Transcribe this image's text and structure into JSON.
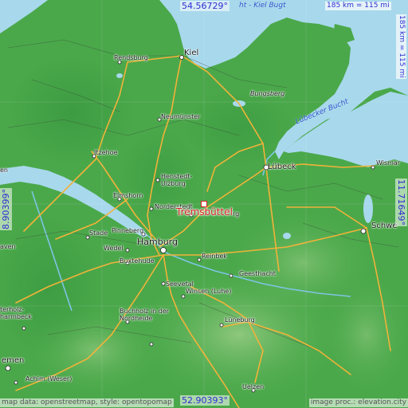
{
  "coords": {
    "north": "54.56729°",
    "south": "52.90393°",
    "west": "8.90399°",
    "east": "11.71649°"
  },
  "scale": {
    "horizontal": "185 km = 115 mi",
    "vertical": "185 km = 115 mi"
  },
  "water_labels": {
    "kiel_bay": "ht - Kiel Bugt",
    "luebeck_bay": "Lübecker Bucht"
  },
  "place": {
    "name": "Tremsbüttel"
  },
  "cities": [
    {
      "id": "kiel",
      "label": "Kiel",
      "size": "mid"
    },
    {
      "id": "rendsburg",
      "label": "Rendsburg",
      "size": "small"
    },
    {
      "id": "bungsberg",
      "label": "Bungsberg",
      "size": "small"
    },
    {
      "id": "neumuenster",
      "label": "Neumünster",
      "size": "small"
    },
    {
      "id": "itzehoe",
      "label": "Itzehoe",
      "size": "small"
    },
    {
      "id": "luebeck",
      "label": "Lübeck",
      "size": "mid"
    },
    {
      "id": "wismar",
      "label": "Wismar",
      "size": "small"
    },
    {
      "id": "henstedt",
      "label": "Henstedt-\nUlzburg",
      "size": "small"
    },
    {
      "id": "norderstedt",
      "label": "Norderstedt",
      "size": "small"
    },
    {
      "id": "elmshorn",
      "label": "Elmshorn",
      "size": "small"
    },
    {
      "id": "ahrensburg",
      "label": "rg",
      "size": "small"
    },
    {
      "id": "stade",
      "label": "Stade",
      "size": "small"
    },
    {
      "id": "pinneberg",
      "label": "Pinneberg",
      "size": "small"
    },
    {
      "id": "hamburg",
      "label": "Hamburg",
      "size": "big"
    },
    {
      "id": "wedel",
      "label": "Wedel",
      "size": "small"
    },
    {
      "id": "buxtehude",
      "label": "Buxtehude",
      "size": "small"
    },
    {
      "id": "reinbek",
      "label": "Reinbek",
      "size": "small"
    },
    {
      "id": "geesthacht",
      "label": "Geesthacht",
      "size": "small"
    },
    {
      "id": "seevetal",
      "label": "Seevetal",
      "size": "small"
    },
    {
      "id": "winsen",
      "label": "Winsen (Luhe)",
      "size": "small"
    },
    {
      "id": "buchholz",
      "label": "Buchholz in der\nNordheide",
      "size": "small"
    },
    {
      "id": "lueneburg",
      "label": "Lüneburg",
      "size": "small"
    },
    {
      "id": "schwerin",
      "label": "Schwe",
      "size": "mid"
    },
    {
      "id": "osterholz",
      "label": "terholz-\nharmbeck",
      "size": "small"
    },
    {
      "id": "bremen",
      "label": "emen",
      "size": "mid"
    },
    {
      "id": "achim",
      "label": "Achim (Weser)",
      "size": "small"
    },
    {
      "id": "uelzen",
      "label": "Uelzen",
      "size": "small"
    },
    {
      "id": "haven",
      "label": "aven",
      "size": "small"
    },
    {
      "id": "en",
      "label": "en",
      "size": "small"
    }
  ],
  "attribution": {
    "left": "map data: openstreetmap, style: opentopomap",
    "right": "image proc.: elevation.city"
  },
  "colors": {
    "sea": "#a8d8ec",
    "land": "#4aa84a",
    "highland": "#8ac27a",
    "road_major": "#f2b23a",
    "marker": "#d42222",
    "coord_text": "#2e2ed0"
  }
}
